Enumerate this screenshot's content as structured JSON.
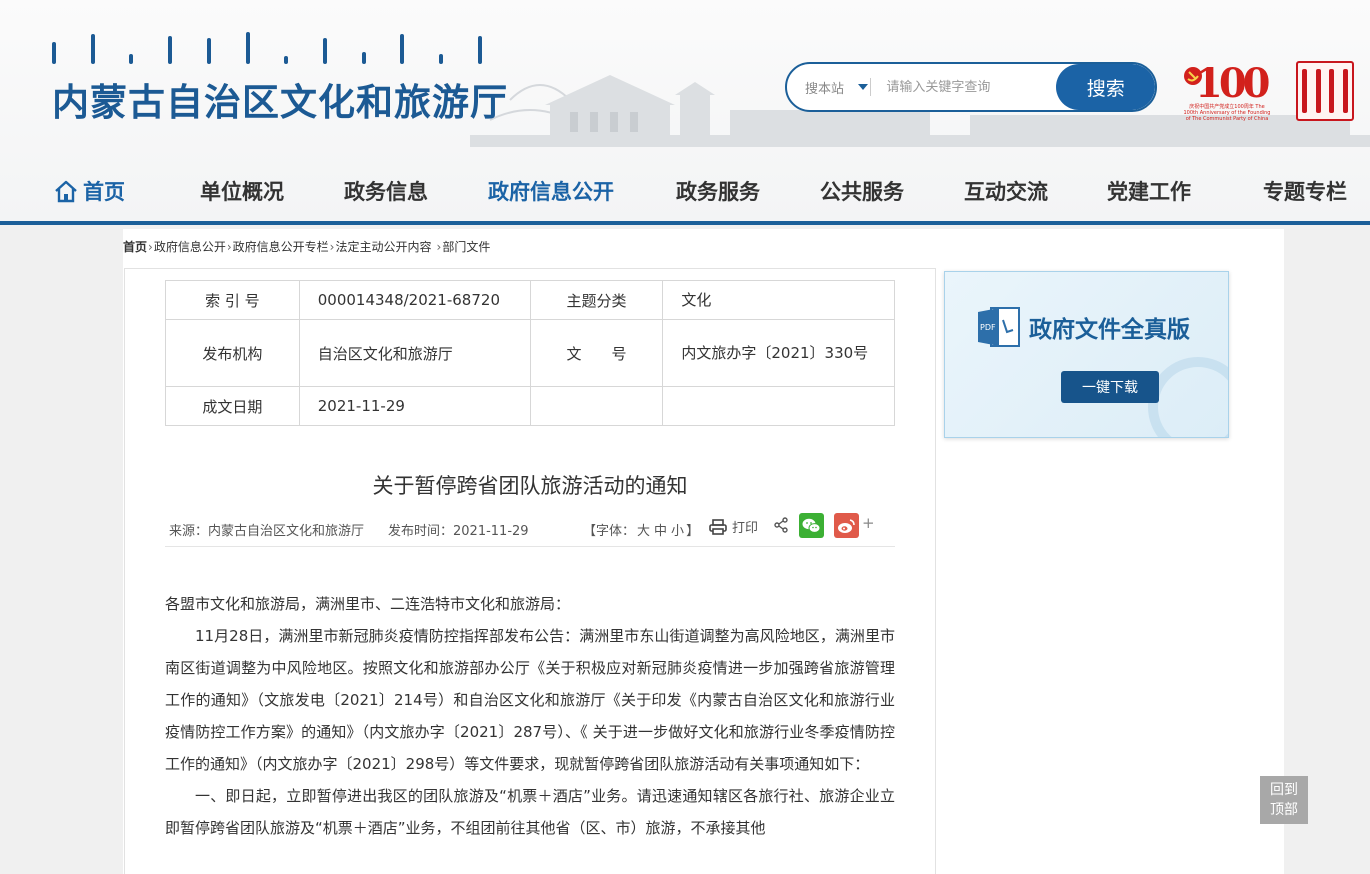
{
  "header": {
    "site_title": "内蒙古自治区文化和旅游厅",
    "search": {
      "scope_label": "搜本站",
      "placeholder": "请输入关键字查询",
      "button_label": "搜索"
    },
    "party_logo": {
      "number": "100",
      "caption": "庆祝中国共产党成立100周年 The 100th Anniversary of the Founding of The Communist Party of China"
    }
  },
  "nav": {
    "home": "首页",
    "items": [
      "单位概况",
      "政务信息",
      "政府信息公开",
      "政务服务",
      "公共服务",
      "互动交流",
      "党建工作",
      "专题专栏"
    ],
    "active": "政府信息公开"
  },
  "breadcrumb": [
    "首页",
    "政府信息公开",
    "政府信息公开专栏",
    "法定主动公开内容",
    "部门文件"
  ],
  "meta": {
    "index_label": "索 引 号",
    "index_value": "000014348/2021-68720",
    "topic_label": "主题分类",
    "topic_value": "文化",
    "org_label": "发布机构",
    "org_value": "自治区文化和旅游厅",
    "docno_label": "文　　号",
    "docno_value": "内文旅办字〔2021〕330号",
    "date_label": "成文日期",
    "date_value": "2021-11-29"
  },
  "article": {
    "title": "关于暂停跨省团队旅游活动的通知",
    "source": "来源：内蒙古自治区文化和旅游厅",
    "publish_time": "发布时间：2021-11-29",
    "font_ctrl_prefix": "【字体：",
    "font_sizes": [
      "大",
      "中",
      "小"
    ],
    "font_ctrl_suffix": "】",
    "print_label": "打印",
    "more_share": "+",
    "paragraphs": [
      "各盟市文化和旅游局，满洲里市、二连浩特市文化和旅游局：",
      "11月28日，满洲里市新冠肺炎疫情防控指挥部发布公告：满洲里市东山街道调整为高风险地区，满洲里市南区街道调整为中风险地区。按照文化和旅游部办公厅《关于积极应对新冠肺炎疫情进一步加强跨省旅游管理工作的通知》（文旅发电〔2021〕214号）和自治区文化和旅游厅《关于印发《内蒙古自治区文化和旅游行业疫情防控工作方案》的通知》（内文旅办字〔2021〕287号）、《 关于进一步做好文化和旅游行业冬季疫情防控工作的通知》（内文旅办字〔2021〕298号）等文件要求，现就暂停跨省团队旅游活动有关事项通知如下：",
      "一、即日起，立即暂停进出我区的团队旅游及“机票＋酒店”业务。请迅速通知辖区各旅行社、旅游企业立即暂停跨省团队旅游及“机票＋酒店”业务，不组团前往其他省（区、市）旅游，不承接其他"
    ]
  },
  "sidebar": {
    "pdf_icon_label": "PDF",
    "pdf_title": "政府文件全真版",
    "download_label": "一键下载"
  },
  "back_top": [
    "回到",
    "顶部"
  ],
  "colors": {
    "brand_blue": "#1b5f99",
    "search_button": "#1b63a6",
    "party_red": "#d2211c",
    "wechat_green": "#3cb034",
    "weibo_red": "#e05a4a"
  }
}
